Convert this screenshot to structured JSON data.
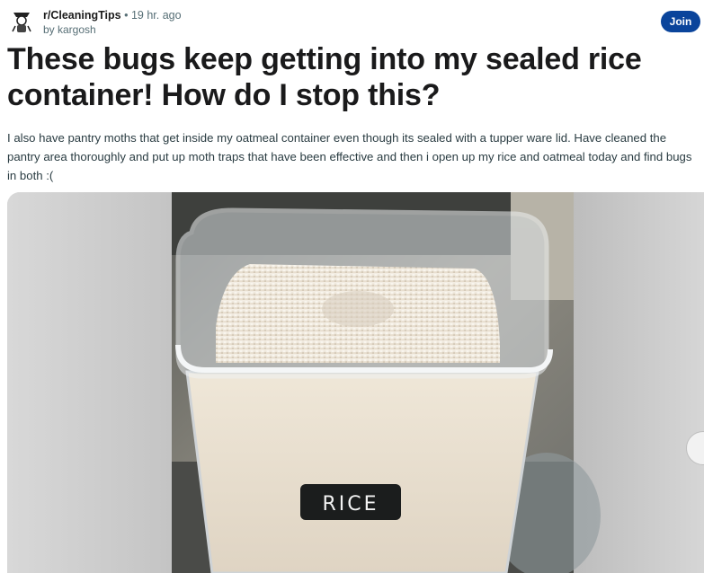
{
  "post": {
    "subreddit": "r/CleaningTips",
    "separator": "•",
    "time": "19 hr. ago",
    "author": "by kargosh",
    "join_label": "Join",
    "title": "These bugs keep getting into my sealed rice container! How do I stop this?",
    "body": "I also have pantry moths that get inside my oatmeal container even though its sealed with a tupper ware lid. Have cleaned the pantry area thoroughly and put up moth traps that have been effective and then i open up my rice and oatmeal today and find bugs in both :("
  },
  "image": {
    "label_text": "RICE"
  },
  "colors": {
    "join_button": "#0a449b",
    "title_text": "#1a1a1b",
    "meta_text": "#576f76"
  },
  "icons": {
    "avatar": "subreddit-avatar-icon",
    "carousel_next": "chevron-right-icon"
  }
}
